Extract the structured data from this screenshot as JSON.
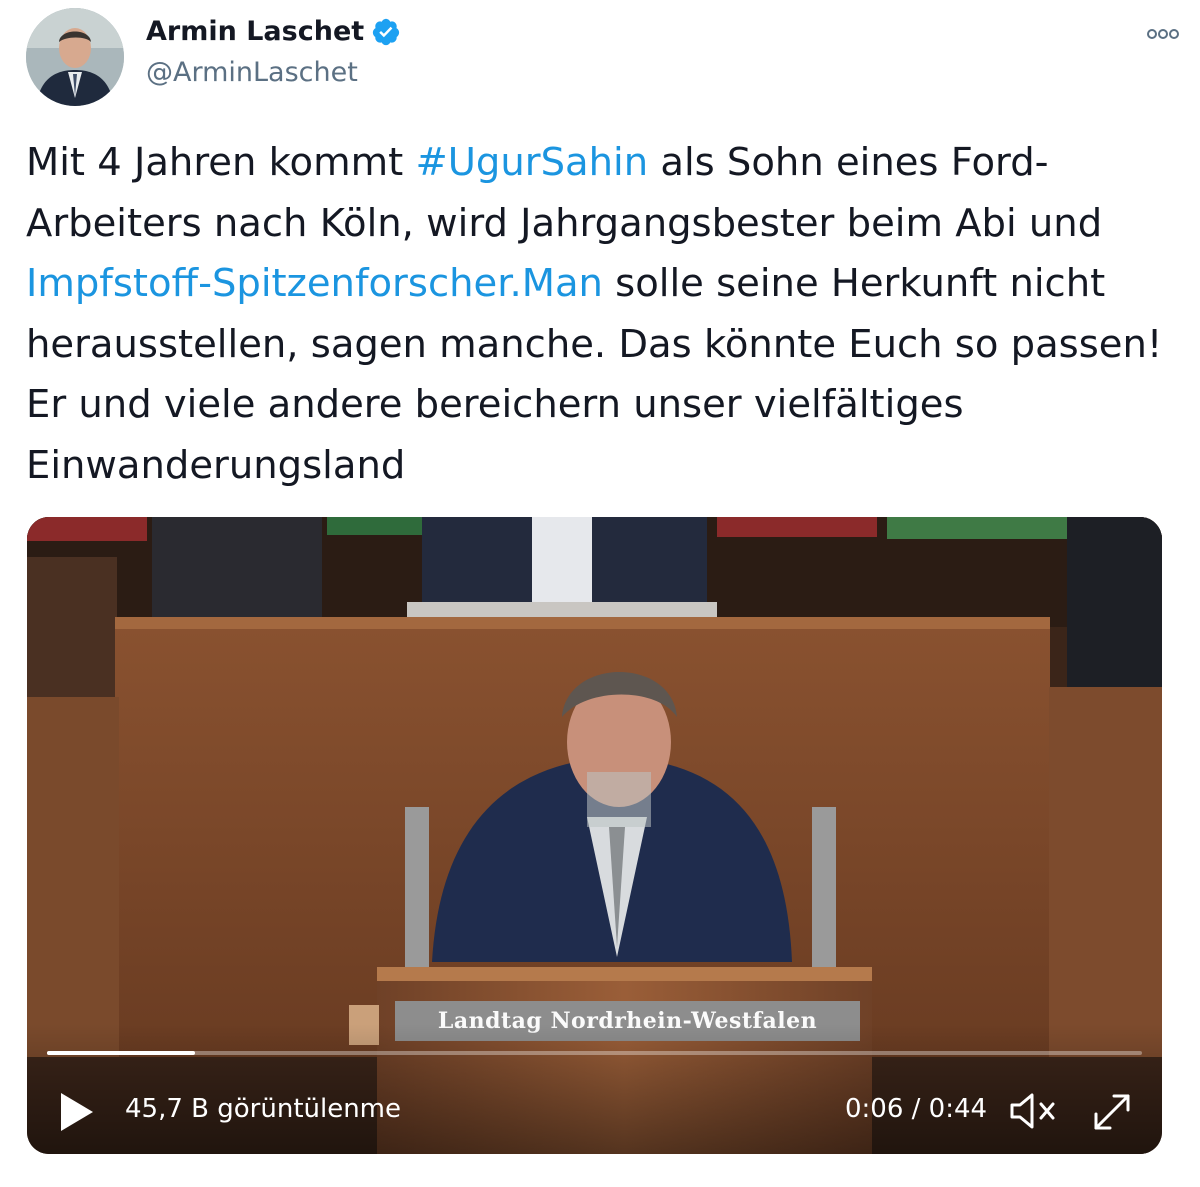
{
  "tweet": {
    "author": {
      "display_name": "Armin Laschet",
      "handle": "@ArminLaschet",
      "verified": true,
      "avatar_icon": "avatar-portrait"
    },
    "more_icon": "more-options-icon",
    "text_parts": [
      {
        "text": "Mit 4 Jahren kommt ",
        "link": false
      },
      {
        "text": "#UgurSahin",
        "link": true
      },
      {
        "text": " als Sohn eines Ford-Arbeiters nach Köln, wird Jahrgangsbester beim Abi und ",
        "link": false
      },
      {
        "text": "Impfstoff-Spitzenforscher.Man",
        "link": true
      },
      {
        "text": " solle seine Herkunft nicht herausstellen, sagen manche. Das könnte Euch so passen! Er und viele andere bereichern unser vielfältiges Einwanderungsland",
        "link": false
      }
    ]
  },
  "video": {
    "views_label": "45,7 B görüntülenme",
    "time_label": "0:06 / 0:44",
    "progress": 0.135,
    "sign_text": "Landtag Nordrhein-Westfalen",
    "icons": {
      "play": "play-icon",
      "mute": "volume-muted-icon",
      "fullscreen": "fullscreen-icon"
    }
  },
  "colors": {
    "link": "#1b95e0",
    "text": "#141823",
    "secondary": "#5b7083",
    "verified": "#1da1f2"
  }
}
